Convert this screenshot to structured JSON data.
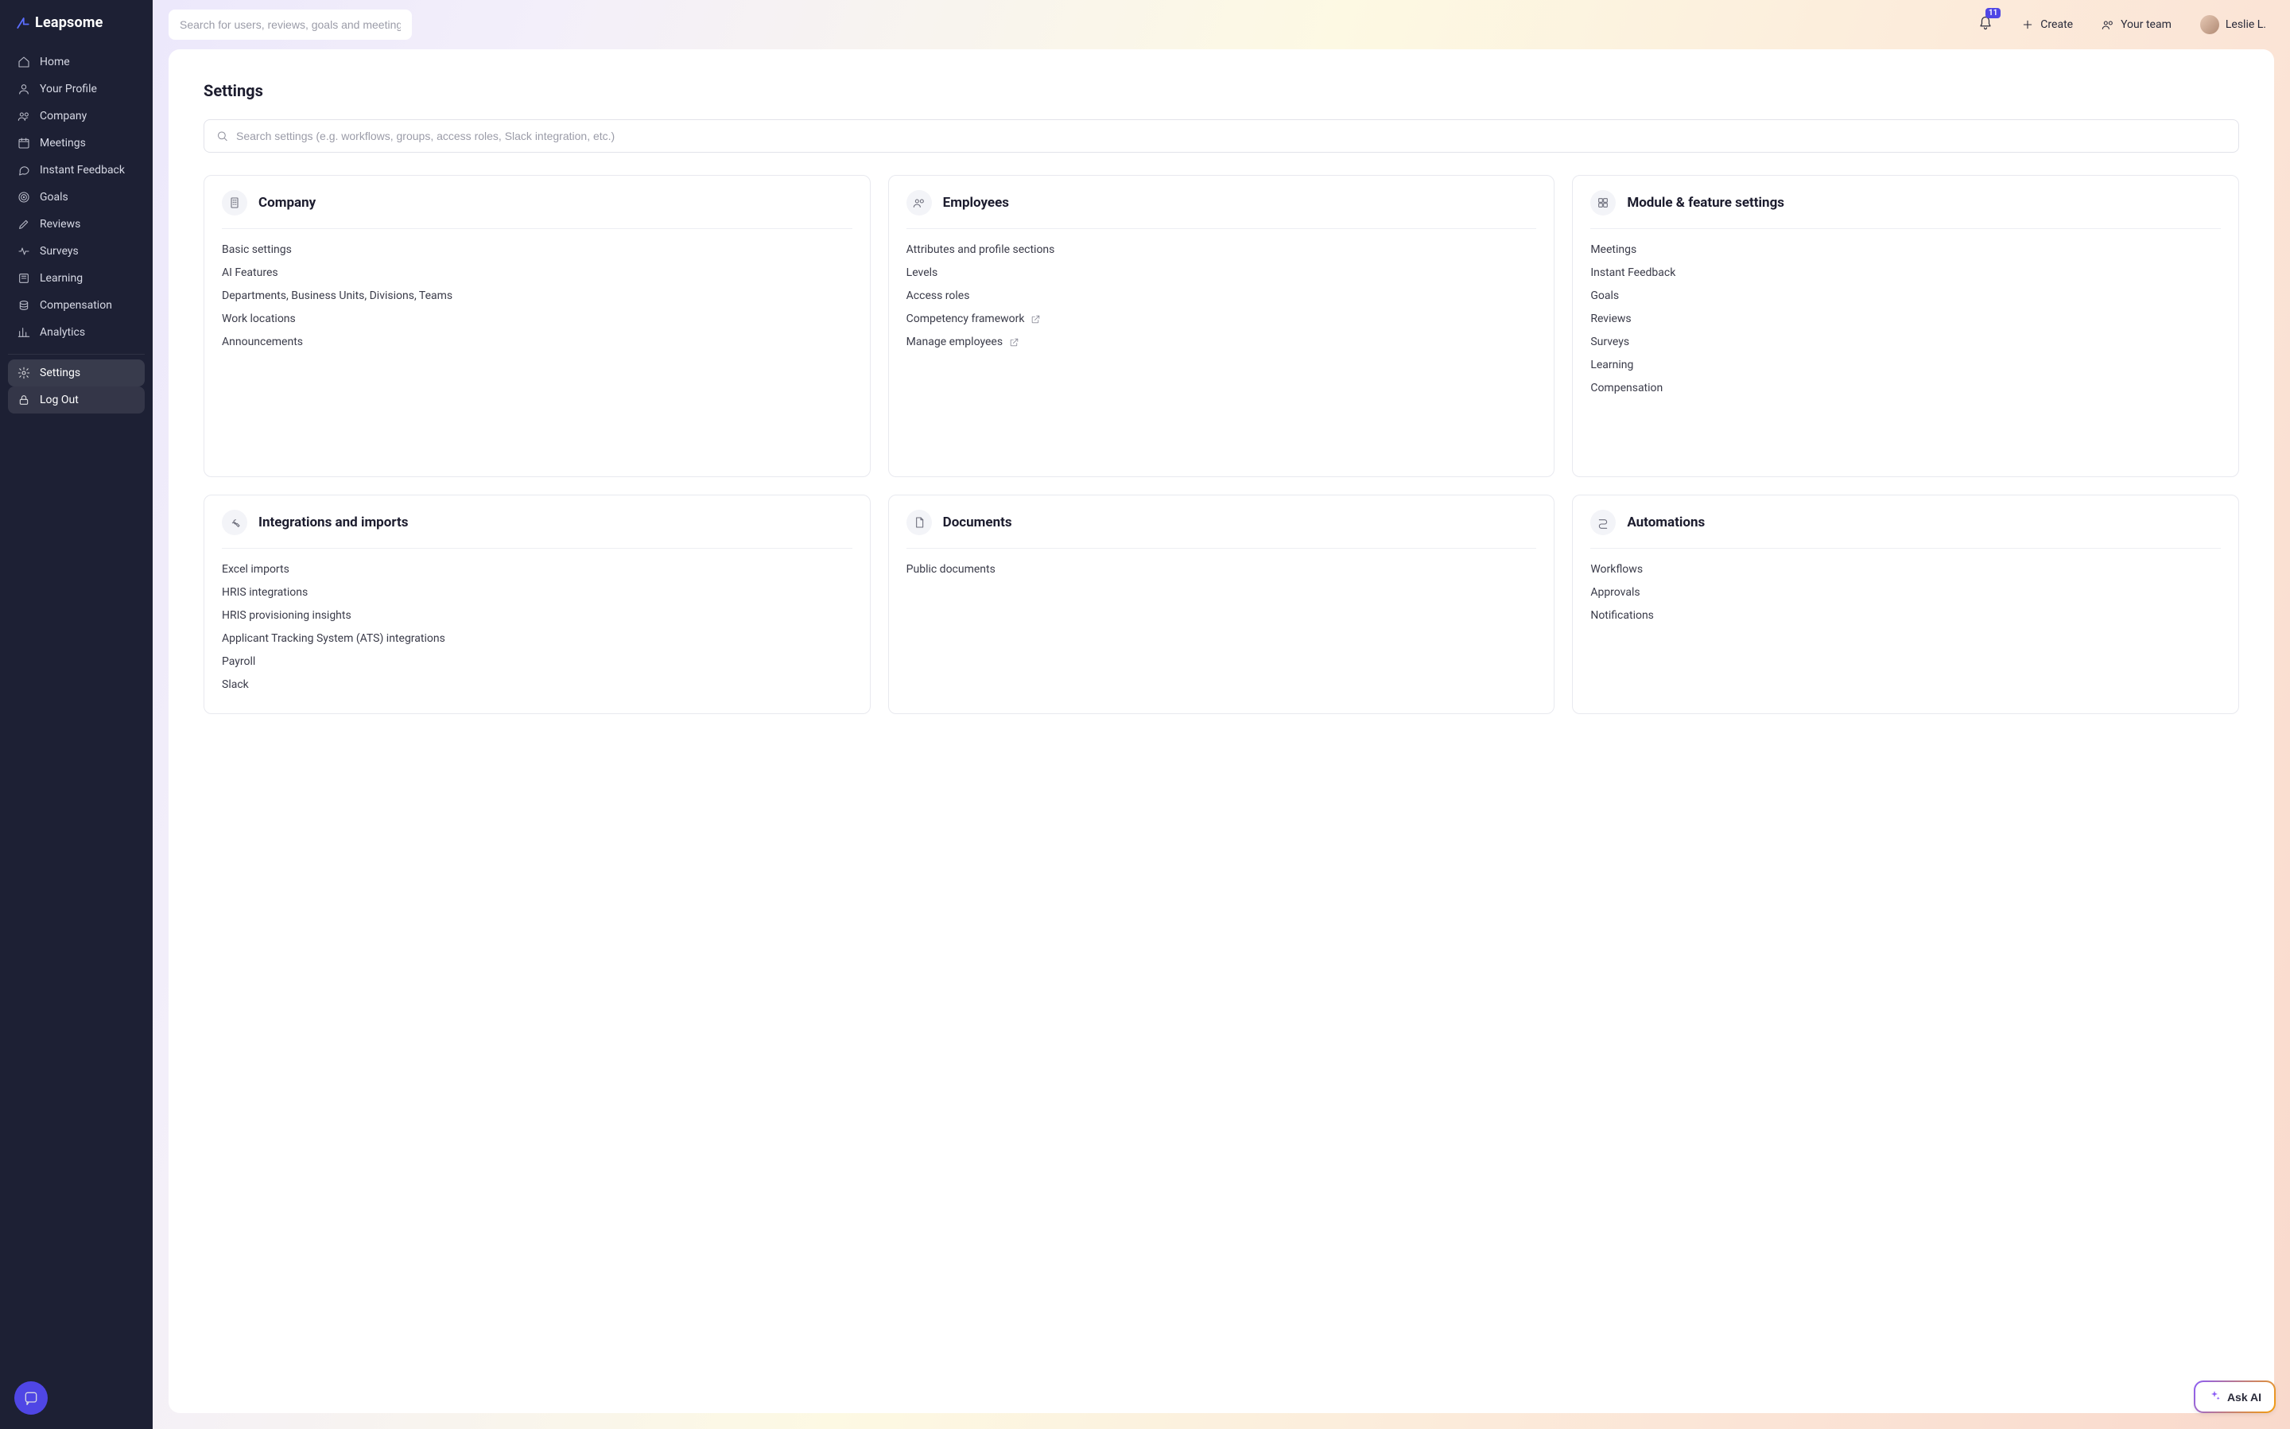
{
  "brand": {
    "name": "Leapsome"
  },
  "search": {
    "placeholder": "Search for users, reviews, goals and meetings"
  },
  "notifications": {
    "count": "11"
  },
  "topActions": {
    "create": "Create",
    "yourTeam": "Your team",
    "userName": "Leslie L."
  },
  "sidebar": {
    "items": [
      {
        "label": "Home"
      },
      {
        "label": "Your Profile"
      },
      {
        "label": "Company"
      },
      {
        "label": "Meetings"
      },
      {
        "label": "Instant Feedback"
      },
      {
        "label": "Goals"
      },
      {
        "label": "Reviews"
      },
      {
        "label": "Surveys"
      },
      {
        "label": "Learning"
      },
      {
        "label": "Compensation"
      },
      {
        "label": "Analytics"
      }
    ],
    "footer": [
      {
        "label": "Settings"
      },
      {
        "label": "Log Out"
      }
    ]
  },
  "page": {
    "title": "Settings",
    "searchPlaceholder": "Search settings (e.g. workflows, groups, access roles, Slack integration, etc.)"
  },
  "cards": {
    "company": {
      "title": "Company",
      "links": [
        "Basic settings",
        "AI Features",
        "Departments, Business Units, Divisions, Teams",
        "Work locations",
        "Announcements"
      ]
    },
    "employees": {
      "title": "Employees",
      "links": [
        {
          "label": "Attributes and profile sections"
        },
        {
          "label": "Levels"
        },
        {
          "label": "Access roles"
        },
        {
          "label": "Competency framework",
          "external": true
        },
        {
          "label": "Manage employees",
          "external": true
        }
      ]
    },
    "modules": {
      "title": "Module & feature settings",
      "links": [
        "Meetings",
        "Instant Feedback",
        "Goals",
        "Reviews",
        "Surveys",
        "Learning",
        "Compensation"
      ]
    },
    "integrations": {
      "title": "Integrations and imports",
      "links": [
        "Excel imports",
        "HRIS integrations",
        "HRIS provisioning insights",
        "Applicant Tracking System (ATS) integrations",
        "Payroll",
        "Slack"
      ]
    },
    "documents": {
      "title": "Documents",
      "links": [
        "Public documents"
      ]
    },
    "automations": {
      "title": "Automations",
      "links": [
        "Workflows",
        "Approvals",
        "Notifications"
      ]
    }
  },
  "askAI": {
    "label": "Ask AI"
  }
}
